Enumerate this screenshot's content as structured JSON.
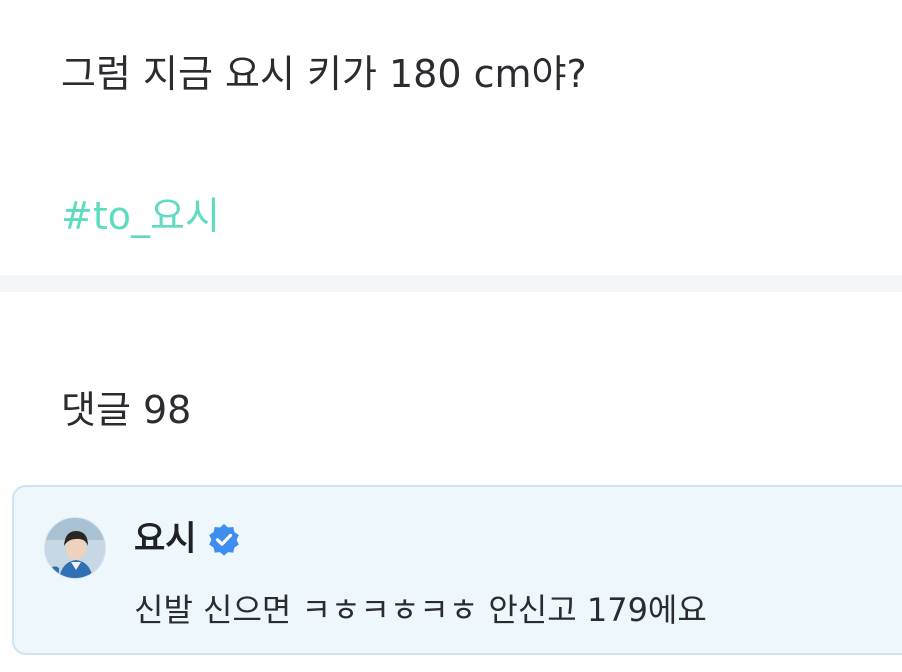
{
  "post": {
    "text": "그럼 지금 요시 키가 180 cm야?",
    "hashtag": "#to_요시"
  },
  "comments": {
    "header": "댓글 98",
    "items": [
      {
        "author": "요시",
        "verified": true,
        "text": "신발 신으면 ㅋㅎㅋㅎㅋㅎ 안신고 179에요"
      }
    ]
  },
  "colors": {
    "hashtag": "#5fdcc0",
    "comment_bg": "#eef7fc",
    "comment_border": "#cfe3f0",
    "verified_badge": "#3d8ef0",
    "divider": "#f4f5f8"
  },
  "icons": {
    "verified": "verified-badge-icon",
    "avatar": "avatar"
  }
}
